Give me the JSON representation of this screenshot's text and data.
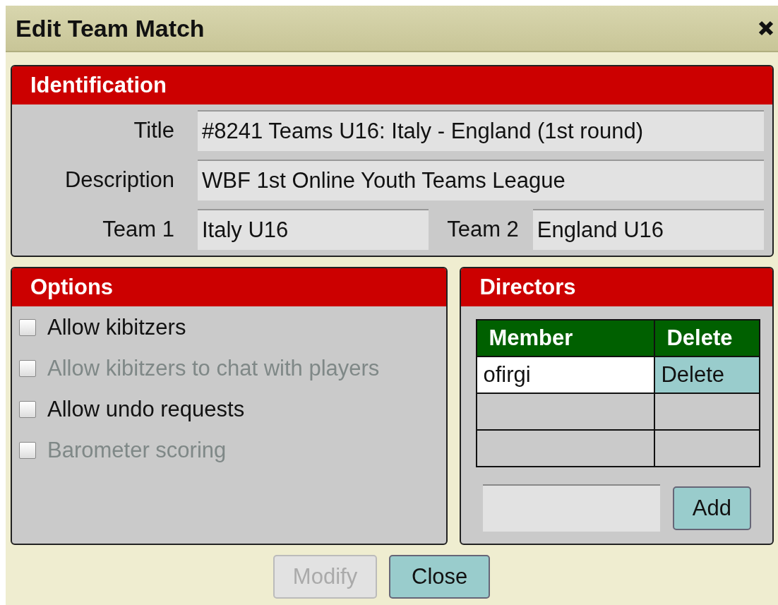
{
  "window": {
    "title": "Edit Team Match"
  },
  "identification": {
    "title": "Identification",
    "fields": [
      {
        "label": "Title",
        "value": "#8241 Teams U16: Italy - England (1st round)"
      },
      {
        "label": "Description",
        "value": "WBF 1st Online Youth Teams League"
      }
    ],
    "teams": [
      {
        "label": "Team 1",
        "value": "Italy U16"
      },
      {
        "label": "Team 2",
        "value": "England U16"
      }
    ]
  },
  "options": {
    "title": "Options",
    "items": [
      {
        "label": "Allow kibitzers",
        "checked": false,
        "disabled": false
      },
      {
        "label": "Allow kibitzers to chat with players",
        "checked": false,
        "disabled": true
      },
      {
        "label": "Allow undo requests",
        "checked": false,
        "disabled": false
      },
      {
        "label": "Barometer scoring",
        "checked": false,
        "disabled": true
      }
    ]
  },
  "directors": {
    "title": "Directors",
    "columns": [
      "Member",
      "Delete"
    ],
    "rows": [
      {
        "member": "ofirgi",
        "action": "Delete"
      }
    ],
    "add_button": "Add"
  },
  "buttons": [
    {
      "label": "Modify",
      "disabled": true
    },
    {
      "label": "Close",
      "disabled": false
    }
  ]
}
